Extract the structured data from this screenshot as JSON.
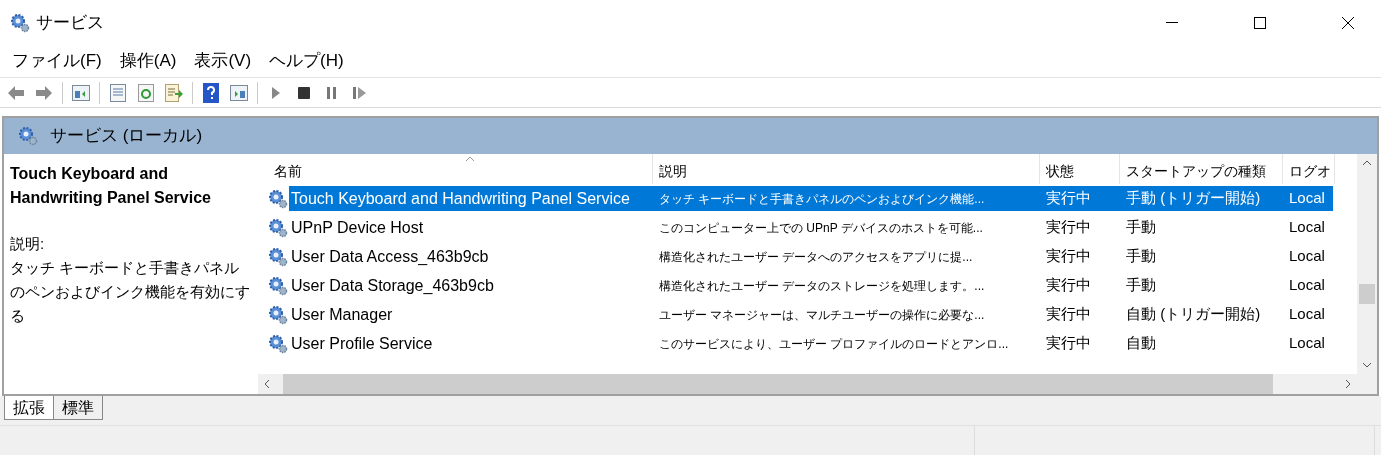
{
  "window": {
    "title": "サービス"
  },
  "menu": [
    "ファイル(F)",
    "操作(A)",
    "表示(V)",
    "ヘルプ(H)"
  ],
  "pane_header": {
    "title": "サービス (ローカル)"
  },
  "details": {
    "title": "Touch Keyboard and Handwriting Panel Service",
    "label": "説明:",
    "description": "タッチ キーボードと手書きパネルのペンおよびインク機能を有効にする"
  },
  "table": {
    "columns": [
      "名前",
      "説明",
      "状態",
      "スタートアップの種類",
      "ログオ"
    ],
    "rows": [
      {
        "name": "Touch Keyboard and Handwriting Panel Service",
        "description": "タッチ キーボードと手書きパネルのペンおよびインク機能...",
        "status": "実行中",
        "startup": "手動 (トリガー開始)",
        "logon": "Local",
        "selected": true
      },
      {
        "name": "UPnP Device Host",
        "description": "このコンピューター上での UPnP デバイスのホストを可能...",
        "status": "実行中",
        "startup": "手動",
        "logon": "Local",
        "selected": false
      },
      {
        "name": "User Data Access_463b9cb",
        "description": "構造化されたユーザー データへのアクセスをアプリに提...",
        "status": "実行中",
        "startup": "手動",
        "logon": "Local",
        "selected": false
      },
      {
        "name": "User Data Storage_463b9cb",
        "description": "構造化されたユーザー データのストレージを処理します。...",
        "status": "実行中",
        "startup": "手動",
        "logon": "Local",
        "selected": false
      },
      {
        "name": "User Manager",
        "description": "ユーザー マネージャーは、マルチユーザーの操作に必要な...",
        "status": "実行中",
        "startup": "自動 (トリガー開始)",
        "logon": "Local",
        "selected": false
      },
      {
        "name": "User Profile Service",
        "description": "このサービスにより、ユーザー プロファイルのロードとアンロ...",
        "status": "実行中",
        "startup": "自動",
        "logon": "Local",
        "selected": false
      }
    ]
  },
  "tabs": [
    {
      "label": "拡張",
      "selected": true
    },
    {
      "label": "標準",
      "selected": false
    }
  ]
}
